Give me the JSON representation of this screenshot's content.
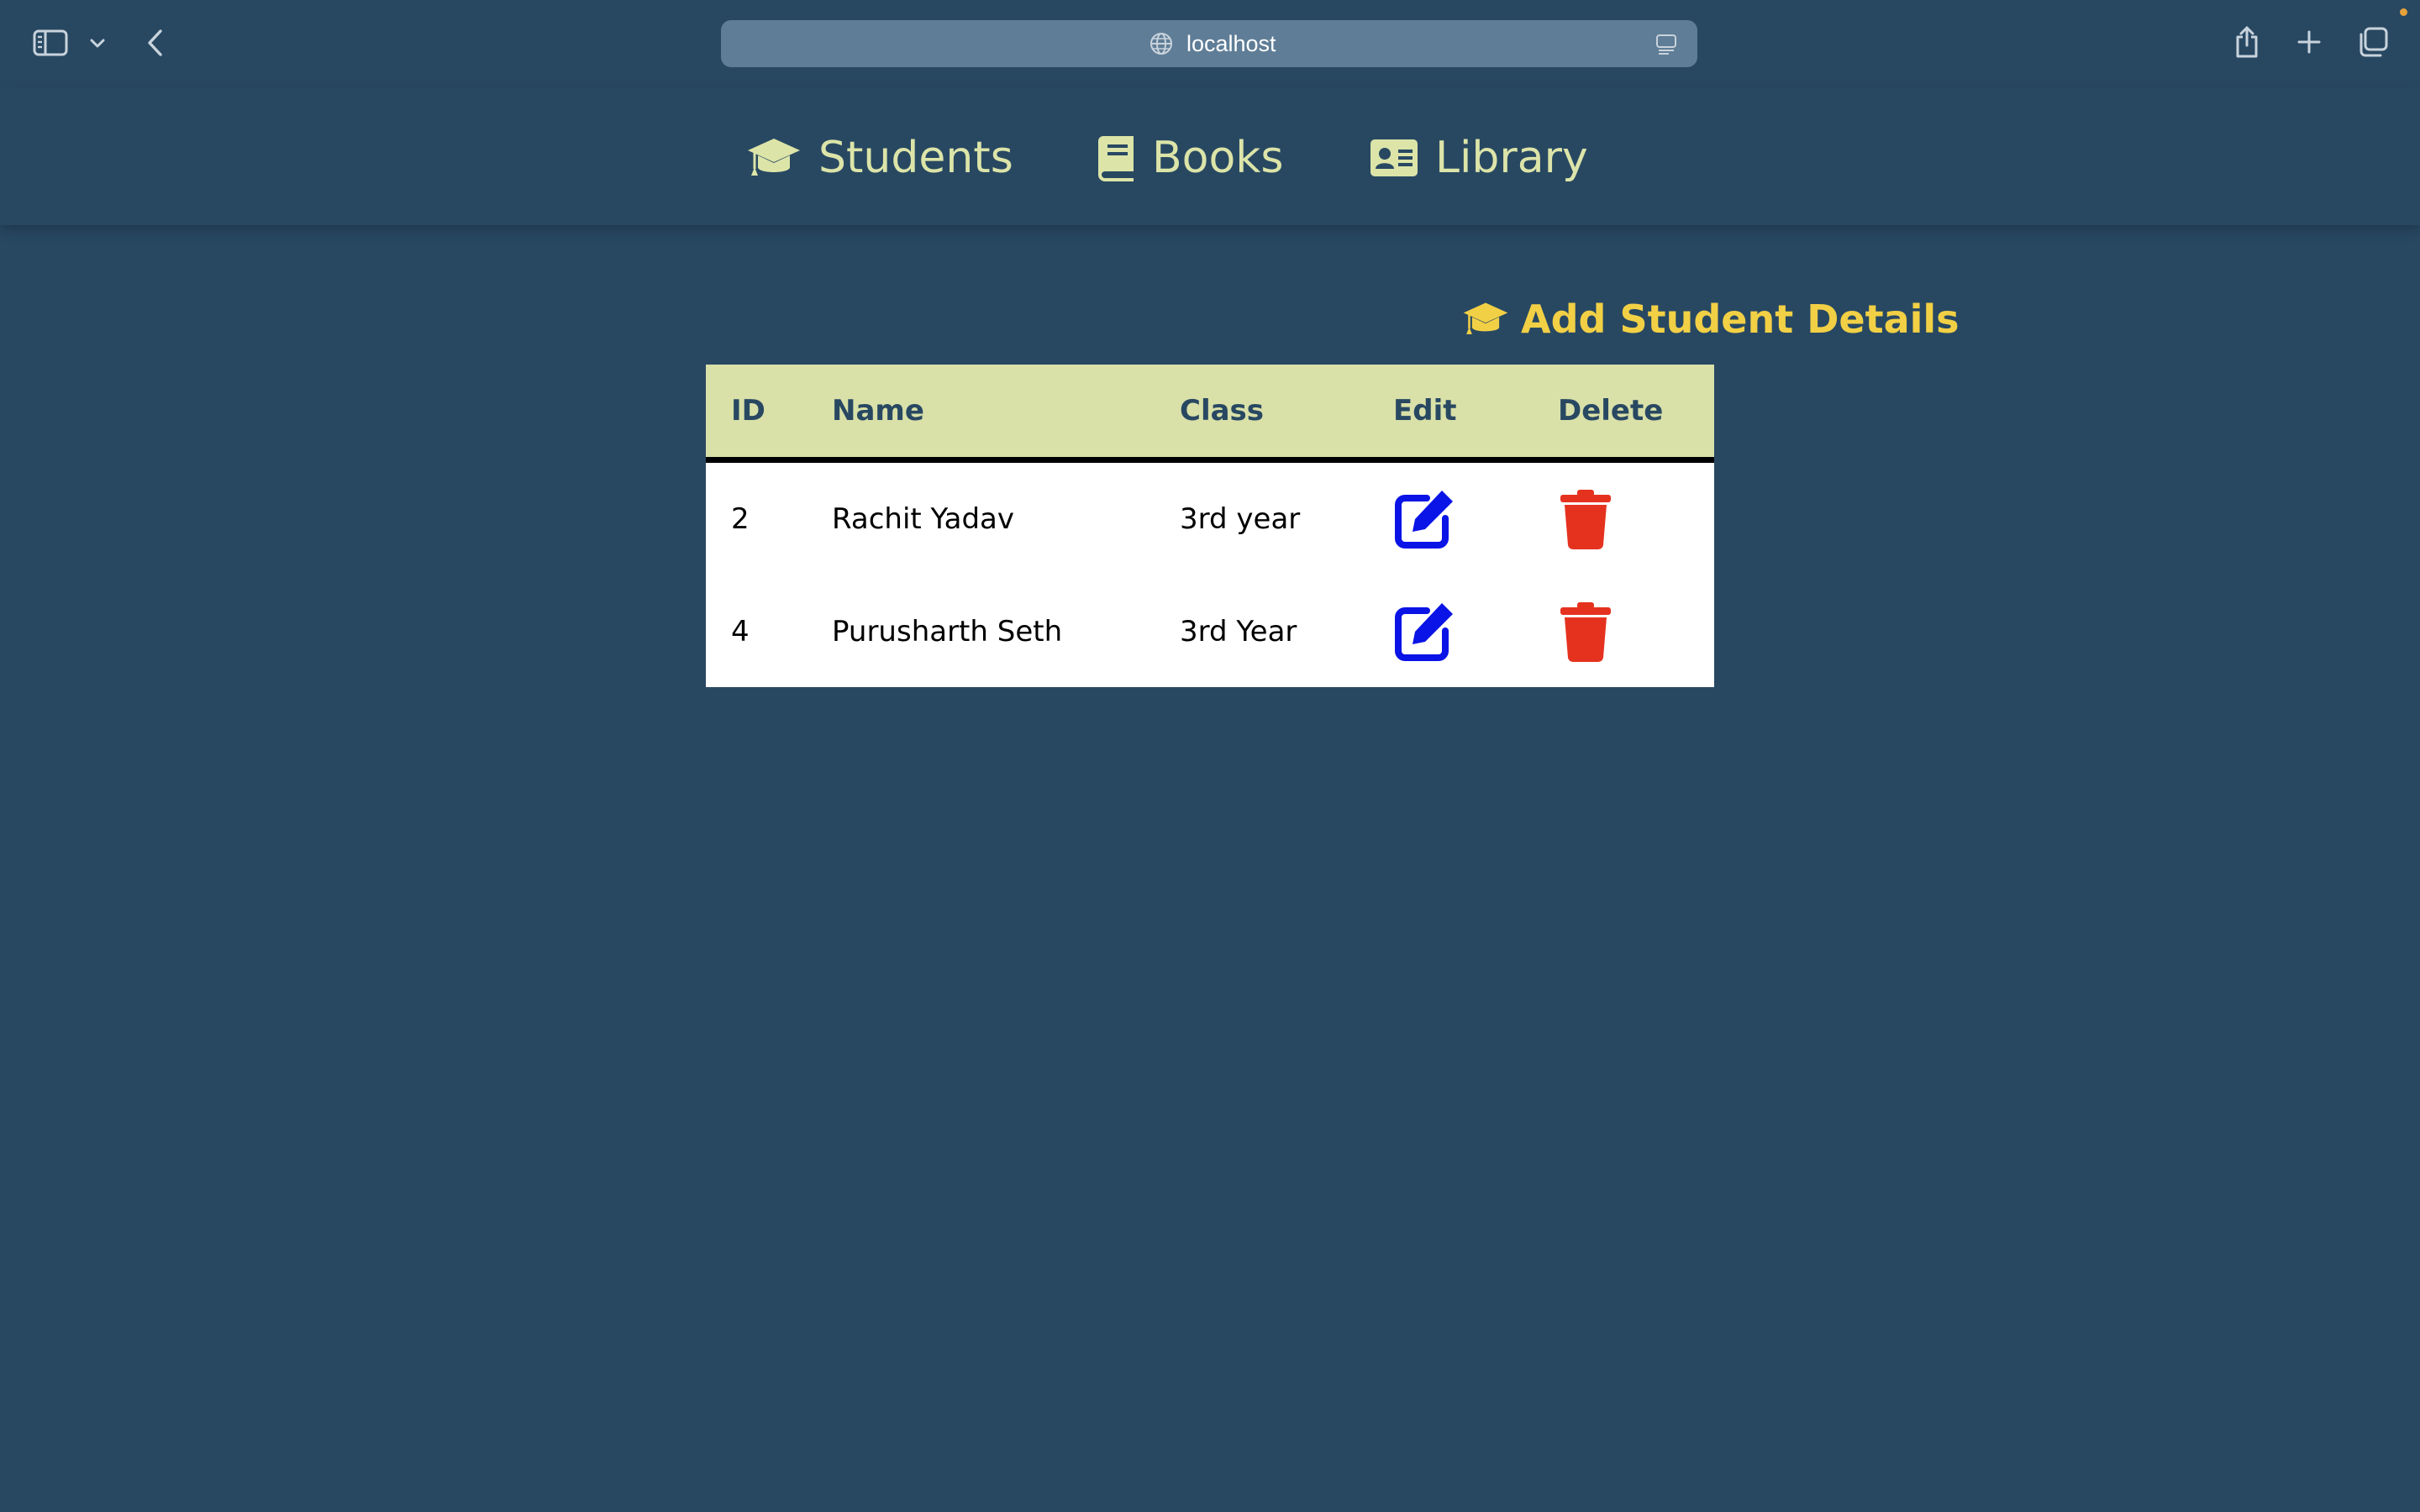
{
  "browser": {
    "address": "localhost",
    "icons": {
      "sidebar": "sidebar-icon",
      "sidebar_menu": "chevron-down-icon",
      "back": "chevron-left-icon",
      "site": "globe-icon",
      "reader": "reader-icon",
      "share": "share-icon",
      "new_tab": "plus-icon",
      "tabs": "tabs-overview-icon"
    }
  },
  "nav": {
    "items": [
      {
        "label": "Students",
        "icon": "graduation-cap-icon"
      },
      {
        "label": "Books",
        "icon": "book-icon"
      },
      {
        "label": "Library",
        "icon": "id-card-icon"
      }
    ]
  },
  "main": {
    "add_label": "Add Student Details",
    "add_icon": "graduation-cap-icon",
    "table": {
      "columns": [
        "ID",
        "Name",
        "Class",
        "Edit",
        "Delete"
      ],
      "rows": [
        {
          "id": "2",
          "name": "Rachit Yadav",
          "class": "3rd year"
        },
        {
          "id": "4",
          "name": "Purusharth Seth",
          "class": "3rd Year"
        }
      ],
      "edit_icon": "edit-icon",
      "delete_icon": "trash-icon"
    }
  },
  "colors": {
    "page_background": "#284862",
    "nav_text": "#dce4a8",
    "accent_yellow": "#f2d045",
    "table_header": "#d9e0a8",
    "edit_blue": "#0a14e6",
    "delete_red": "#e5321f"
  }
}
